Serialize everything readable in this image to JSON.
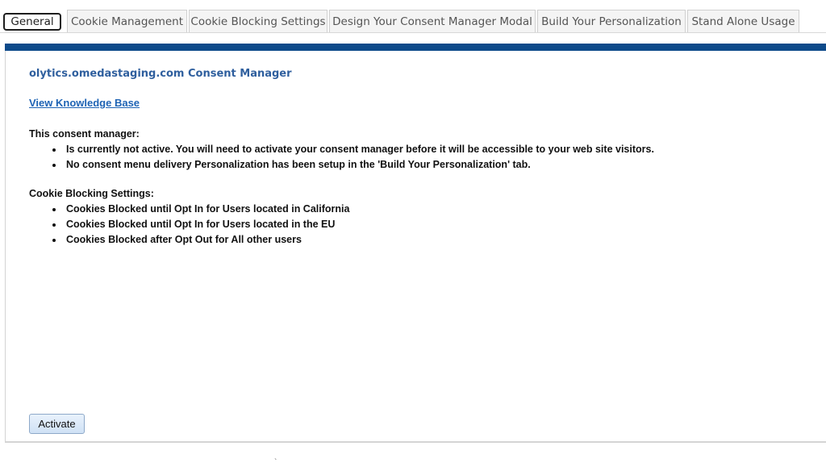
{
  "tabs": [
    {
      "label": "General",
      "active": true
    },
    {
      "label": "Cookie Management",
      "active": false
    },
    {
      "label": "Cookie Blocking Settings",
      "active": false
    },
    {
      "label": "Design Your Consent Manager Modal",
      "active": false
    },
    {
      "label": "Build Your Personalization",
      "active": false
    },
    {
      "label": "Stand Alone Usage",
      "active": false
    }
  ],
  "panel": {
    "title": "olytics.omedastaging.com Consent Manager",
    "knowledge_base_link": "View Knowledge Base",
    "consent_section": {
      "heading": "This consent manager:",
      "items": [
        "Is currently not active. You will need to activate your consent manager before it will be accessible to your web site visitors.",
        "No consent menu delivery Personalization has been setup in the 'Build Your Personalization' tab."
      ]
    },
    "cookie_section": {
      "heading": "Cookie Blocking Settings:",
      "items": [
        "Cookies Blocked until Opt In for Users located in California",
        "Cookies Blocked until Opt In for Users located in the EU",
        "Cookies Blocked after Opt Out for All other users"
      ]
    },
    "activate_label": "Activate"
  },
  "colors": {
    "accent_bar": "#0d4a8a",
    "title": "#2f5f9e",
    "link": "#1e63b4"
  },
  "misc": {
    "stray_mark": "`"
  }
}
